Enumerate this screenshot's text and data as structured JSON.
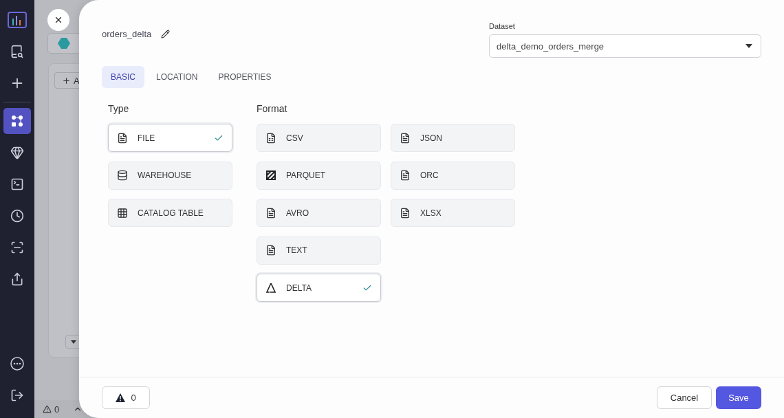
{
  "sidebar": {
    "items": [
      {
        "selected": false
      },
      {
        "selected": false
      },
      {
        "selected": false
      },
      {
        "selected": true
      },
      {
        "selected": false
      },
      {
        "selected": false
      },
      {
        "selected": false
      },
      {
        "selected": false
      },
      {
        "selected": false
      }
    ],
    "bottom_items": [
      {
        "selected": false
      },
      {
        "selected": false
      }
    ]
  },
  "background": {
    "add_button": "A",
    "status": {
      "warnings": "0"
    }
  },
  "dialog": {
    "name": "orders_delta",
    "dataset": {
      "label": "Dataset",
      "value": "delta_demo_orders_merge"
    },
    "tabs": [
      {
        "label": "BASIC",
        "selected": true
      },
      {
        "label": "LOCATION",
        "selected": false
      },
      {
        "label": "PROPERTIES",
        "selected": false
      }
    ],
    "type": {
      "label": "Type",
      "options": [
        {
          "label": "FILE",
          "selected": true
        },
        {
          "label": "WAREHOUSE",
          "selected": false
        },
        {
          "label": "CATALOG TABLE",
          "selected": false
        }
      ]
    },
    "format": {
      "label": "Format",
      "options": [
        {
          "label": "CSV",
          "selected": false
        },
        {
          "label": "JSON",
          "selected": false
        },
        {
          "label": "PARQUET",
          "selected": false
        },
        {
          "label": "ORC",
          "selected": false
        },
        {
          "label": "AVRO",
          "selected": false
        },
        {
          "label": "XLSX",
          "selected": false
        },
        {
          "label": "TEXT",
          "selected": false
        },
        {
          "label": "DELTA",
          "selected": true
        }
      ]
    },
    "warnings": "0",
    "buttons": {
      "cancel": "Cancel",
      "save": "Save"
    }
  }
}
